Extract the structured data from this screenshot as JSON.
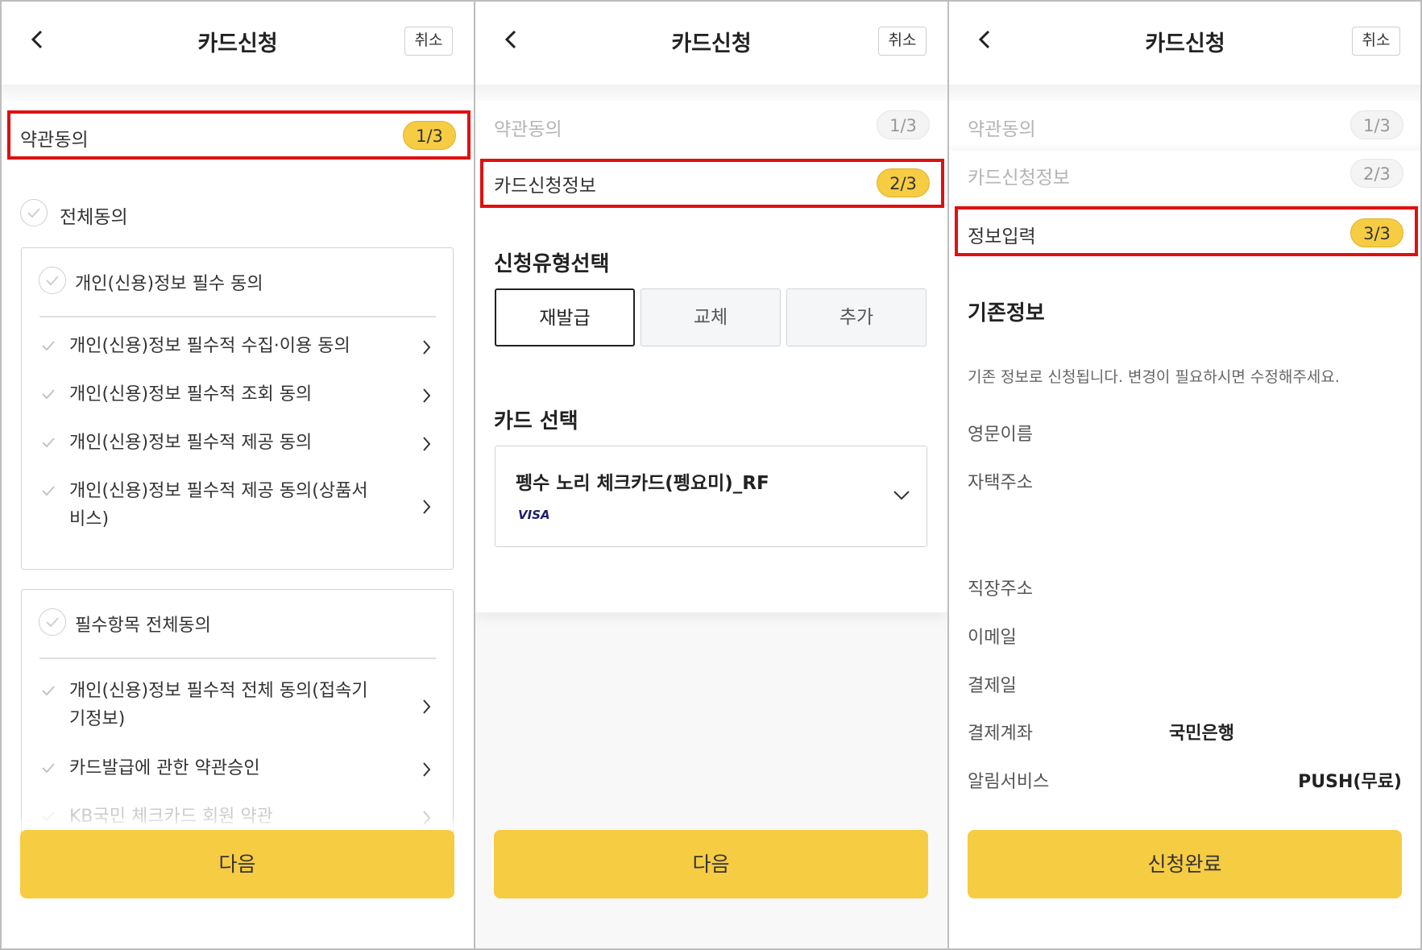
{
  "header": {
    "title": "카드신청",
    "cancel_label": "취소"
  },
  "steps": {
    "terms": {
      "label": "약관동의",
      "badge": "1/3"
    },
    "card_info": {
      "label": "카드신청정보",
      "badge": "2/3"
    },
    "input": {
      "label": "정보입력",
      "badge": "3/3"
    }
  },
  "panel1": {
    "agree_all": "전체동의",
    "group1": {
      "title": "개인(신용)정보 필수 동의",
      "items": [
        "개인(신용)정보 필수적 수집·이용 동의",
        "개인(신용)정보 필수적 조회 동의",
        "개인(신용)정보 필수적 제공 동의",
        "개인(신용)정보 필수적 제공 동의(상품서비스)"
      ]
    },
    "group2": {
      "title": "필수항목 전체동의",
      "items": [
        "개인(신용)정보 필수적 전체 동의(접속기기정보)",
        "카드발급에 관한 약관승인",
        "KB국민 체크카드 회원 약관"
      ]
    },
    "next_label": "다음"
  },
  "panel2": {
    "type_title": "신청유형선택",
    "types": [
      "재발급",
      "교체",
      "추가"
    ],
    "selected_type": "재발급",
    "card_title": "카드 선택",
    "card_name": "펭수 노리 체크카드(펭요미)_RF",
    "card_brand": "VISA",
    "next_label": "다음"
  },
  "panel3": {
    "section_title": "기존정보",
    "description": "기존 정보로 신청됩니다. 변경이 필요하시면 수정해주세요.",
    "fields": {
      "english_name": "영문이름",
      "home_address": "자택주소",
      "work_address": "직장주소",
      "email": "이메일",
      "payment_day": "결제일",
      "payment_account": "결제계좌",
      "notification": "알림서비스"
    },
    "values": {
      "payment_account": "국민은행",
      "notification": "PUSH(무료)"
    },
    "complete_label": "신청완료"
  },
  "colors": {
    "accent": "#f6cc43",
    "highlight": "#e01010"
  }
}
